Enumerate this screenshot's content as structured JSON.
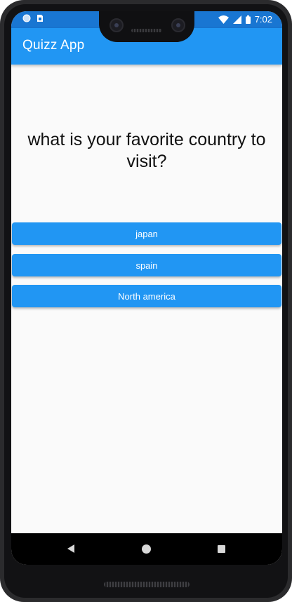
{
  "status_bar": {
    "time": "7:02",
    "left_icons": [
      "circle-icon",
      "sim-card-icon"
    ],
    "right_icons": [
      "wifi-icon",
      "signal-icon",
      "battery-icon"
    ]
  },
  "app_bar": {
    "title": "Quizz App"
  },
  "quiz": {
    "question": "what is your favorite country to visit?",
    "answers": [
      {
        "label": "japan"
      },
      {
        "label": "spain"
      },
      {
        "label": "North america"
      }
    ]
  },
  "navigation": {
    "icons": [
      "back-icon",
      "home-icon",
      "recent-apps-icon"
    ]
  },
  "colors": {
    "primary": "#2196f3",
    "primary_dark": "#1976d2",
    "background": "#fafafa"
  }
}
